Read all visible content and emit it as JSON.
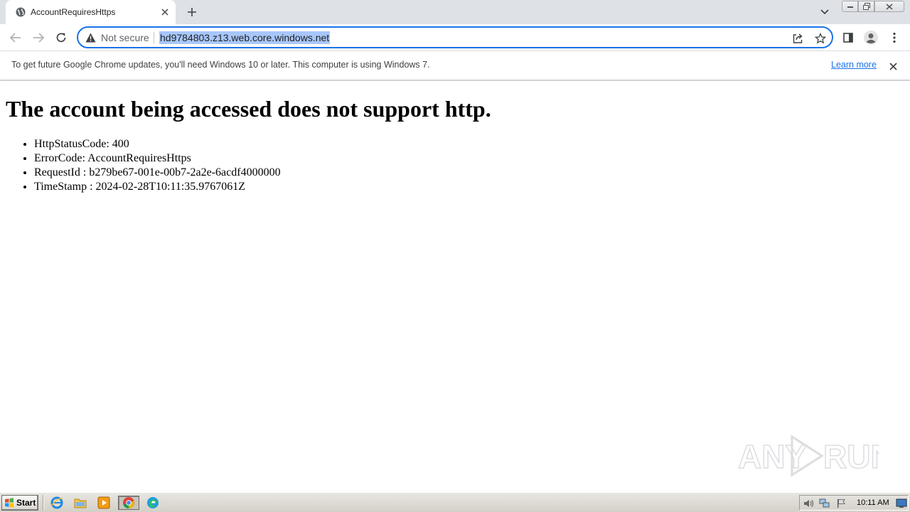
{
  "browser": {
    "tab": {
      "title": "AccountRequiresHttps",
      "favicon": "globe-icon"
    },
    "omnibox": {
      "security_label": "Not secure",
      "url": "hd9784803.z13.web.core.windows.net",
      "selection_color": "#a8c7fa",
      "focus_color": "#1a73e8"
    },
    "infobar": {
      "message": "To get future Google Chrome updates, you'll need Windows 10 or later. This computer is using Windows 7.",
      "link": "Learn more"
    }
  },
  "page": {
    "heading": "The account being accessed does not support http.",
    "details": [
      "HttpStatusCode: 400",
      "ErrorCode: AccountRequiresHttps",
      "RequestId : b279be67-001e-00b7-2a2e-6acdf4000000",
      "TimeStamp : 2024-02-28T10:11:35.9767061Z"
    ]
  },
  "watermark": {
    "text": "ANY RUN"
  },
  "taskbar": {
    "start_label": "Start",
    "apps": [
      "internet-explorer-icon",
      "folder-icon",
      "media-player-icon",
      "chrome-icon",
      "edge-icon"
    ],
    "clock": "10:11 AM"
  }
}
